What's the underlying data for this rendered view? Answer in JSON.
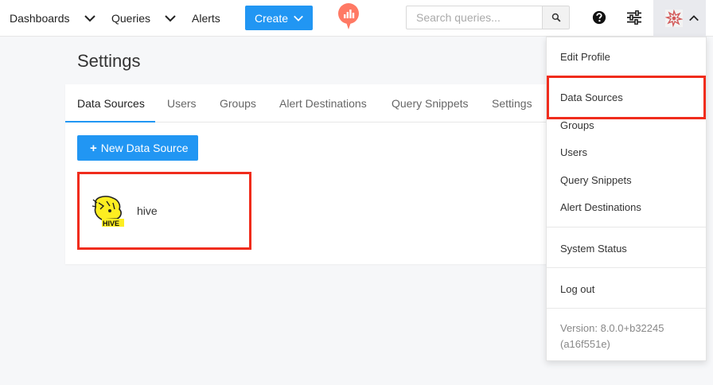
{
  "nav": {
    "dashboards": "Dashboards",
    "queries": "Queries",
    "alerts": "Alerts",
    "create": "Create",
    "search_placeholder": "Search queries..."
  },
  "page": {
    "title": "Settings",
    "tabs": [
      "Data Sources",
      "Users",
      "Groups",
      "Alert Destinations",
      "Query Snippets",
      "Settings"
    ],
    "active_tab": "Data Sources",
    "new_button": "New Data Source",
    "data_sources": [
      {
        "name": "hive",
        "logo_text": "HIVE"
      }
    ]
  },
  "menu": {
    "edit_profile": "Edit Profile",
    "data_sources": "Data Sources",
    "groups": "Groups",
    "users": "Users",
    "query_snippets": "Query Snippets",
    "alert_destinations": "Alert Destinations",
    "system_status": "System Status",
    "log_out": "Log out",
    "version_line1": "Version: 8.0.0+b32245",
    "version_line2": "(a16f551e)"
  },
  "colors": {
    "primary": "#2196f3",
    "highlight": "#f02c1c",
    "logo": "#ff7964"
  },
  "icons": [
    "chevron-down-icon",
    "redash-logo-icon",
    "search-icon",
    "help-icon",
    "settings-sliders-icon",
    "avatar-icon",
    "chevron-up-icon",
    "plus-icon",
    "hive-logo-icon"
  ]
}
